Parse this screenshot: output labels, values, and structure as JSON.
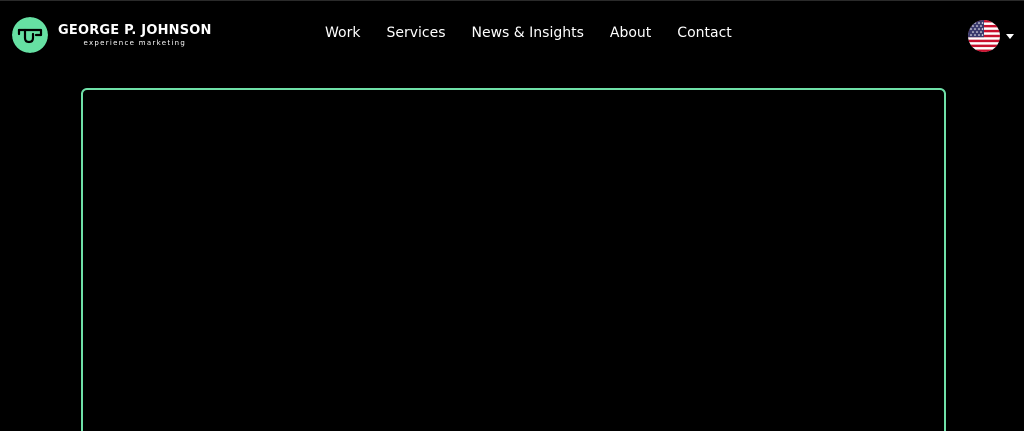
{
  "brand": {
    "name": "GEORGE P. JOHNSON",
    "tagline": "experience marketing",
    "logo_icon": "gpj-logo-icon",
    "accent_color": "#66e0a3"
  },
  "nav": {
    "items": [
      {
        "label": "Work"
      },
      {
        "label": "Services"
      },
      {
        "label": "News & Insights"
      },
      {
        "label": "About"
      },
      {
        "label": "Contact"
      }
    ]
  },
  "locale": {
    "flag_icon": "us-flag-icon",
    "dropdown_icon": "caret-down-icon"
  },
  "content": {
    "frame_border_color": "#6fe0a8"
  }
}
